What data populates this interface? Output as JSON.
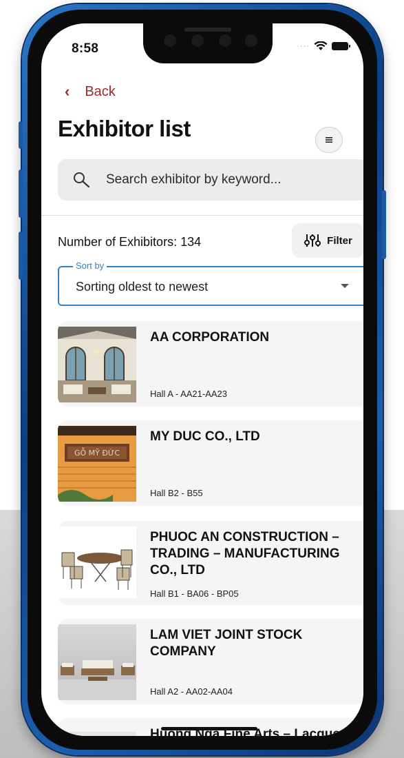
{
  "status_bar": {
    "time": "8:58"
  },
  "nav": {
    "back_label": "Back"
  },
  "page": {
    "title": "Exhibitor list"
  },
  "search": {
    "placeholder": "Search exhibitor by keyword..."
  },
  "summary": {
    "count_label": "Number of Exhibitors: 134",
    "filter_label": "Filter"
  },
  "sort": {
    "legend": "Sort by",
    "value": "Sorting oldest to newest"
  },
  "exhibitors": [
    {
      "name": "AA CORPORATION",
      "hall": "Hall A - AA21-AA23",
      "image": "interior-room-photo"
    },
    {
      "name": "MY DUC CO., LTD",
      "hall": "Hall B2 - B55",
      "image": "wooden-sign-photo"
    },
    {
      "name": "PHUOC AN CONSTRUCTION – TRADING – MANUFACTURING CO., LTD",
      "hall": "Hall B1 - BA06 - BP05",
      "image": "outdoor-table-chairs-photo"
    },
    {
      "name": "LAM VIET JOINT STOCK COMPANY",
      "hall": "Hall A2 - AA02-AA04",
      "image": "sofa-set-photo"
    },
    {
      "name": "Huong Nga Fine Arts – Lacquer Furniture & Accessories",
      "hall": "",
      "image": "placeholder-photo"
    }
  ],
  "colors": {
    "back_link": "#9e2a2a",
    "sort_border": "#2f80d0",
    "phone_frame": "#1c5fae"
  }
}
